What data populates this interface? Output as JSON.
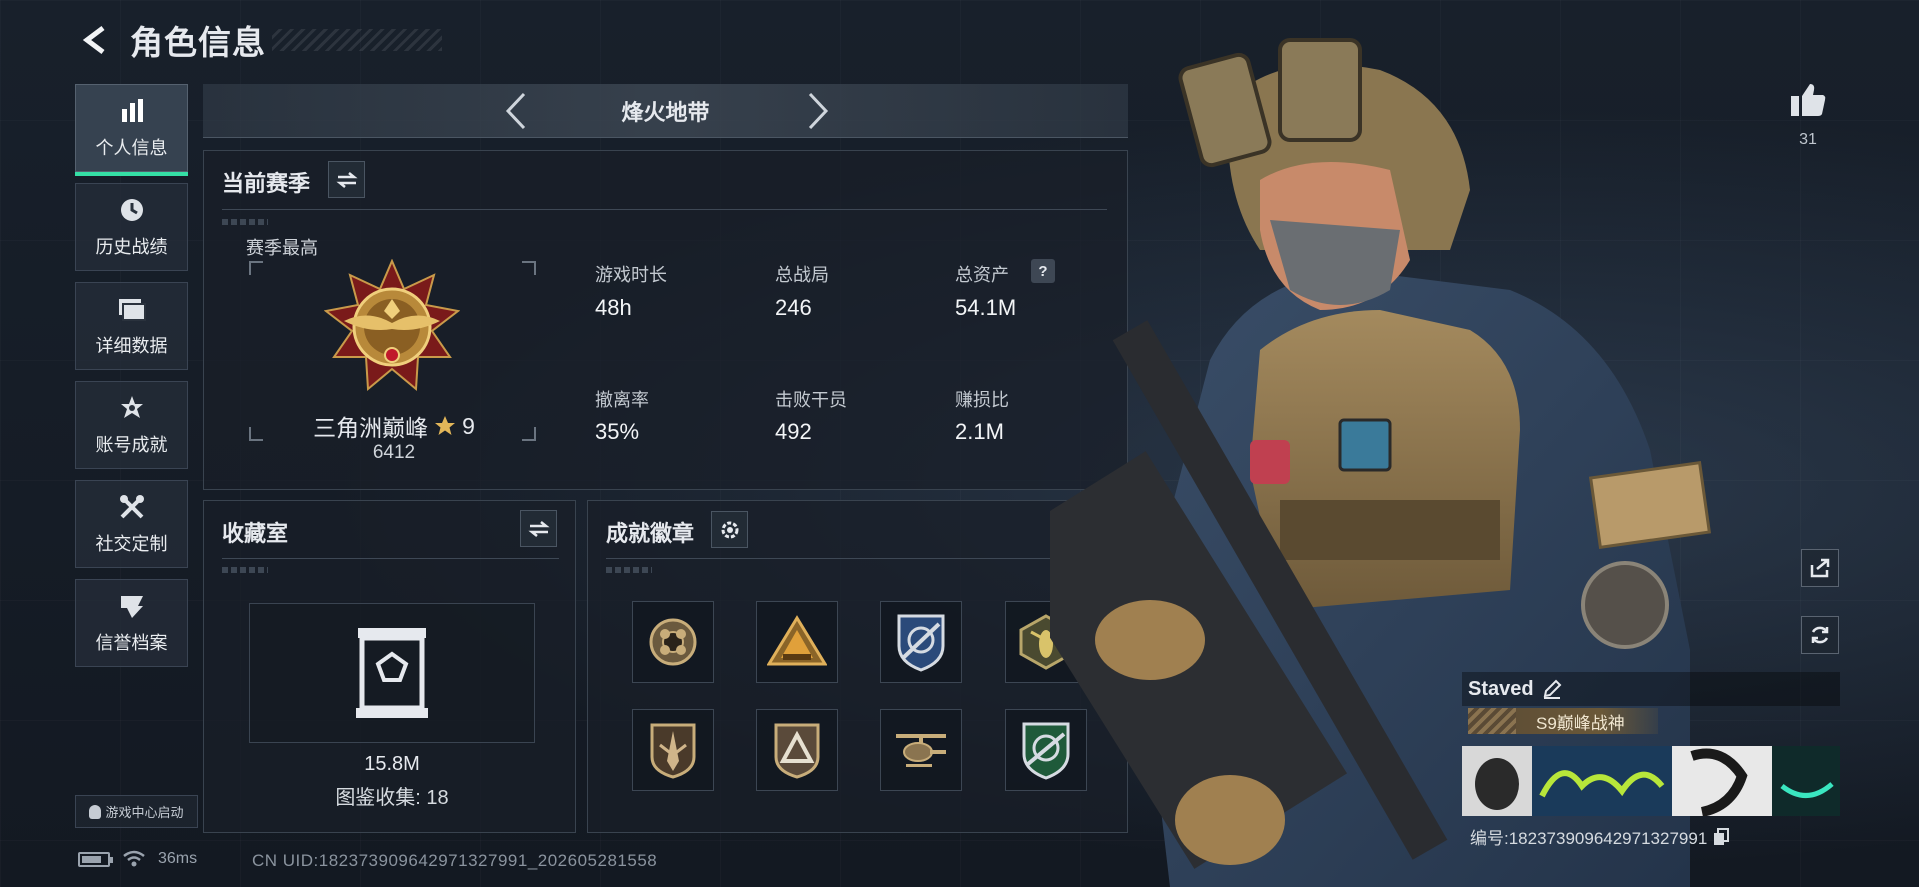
{
  "header": {
    "title": "角色信息"
  },
  "nav": {
    "items": [
      {
        "label": "个人信息",
        "icon": "bar-chart-icon",
        "active": true
      },
      {
        "label": "历史战绩",
        "icon": "clock-icon"
      },
      {
        "label": "详细数据",
        "icon": "folder-icon"
      },
      {
        "label": "账号成就",
        "icon": "achievement-star-icon"
      },
      {
        "label": "社交定制",
        "icon": "tools-icon"
      },
      {
        "label": "信誉档案",
        "icon": "reputation-emblem-icon"
      }
    ],
    "game_center": "游戏中心启动"
  },
  "status": {
    "ping": "36ms",
    "uid": "CN UID:1823739096429713279​91_202605281558"
  },
  "mode": {
    "title": "烽火地带"
  },
  "season": {
    "title": "当前赛季",
    "peak_label": "赛季最高",
    "rank_name": "三角洲巅峰",
    "rank_stars": "9",
    "rank_score": "6412",
    "stats": [
      {
        "label": "游戏时长",
        "value": "48h"
      },
      {
        "label": "总战局",
        "value": "246"
      },
      {
        "label": "总资产",
        "value": "54.1M",
        "help": "?"
      },
      {
        "label": "撤离率",
        "value": "35%"
      },
      {
        "label": "击败干员",
        "value": "492"
      },
      {
        "label": "赚损比",
        "value": "2.1M"
      }
    ]
  },
  "collection": {
    "title": "收藏室",
    "value": "15.8M",
    "count_text": "图鉴收集:  18"
  },
  "badges": {
    "title": "成就徽章",
    "items": [
      "rose-emblem",
      "pyramid-emblem",
      "shield-target-emblem",
      "wasp-emblem",
      "sword-emblem",
      "triangle-emblem",
      "helicopter-emblem",
      "green-shield-emblem"
    ]
  },
  "profile": {
    "likes": "31",
    "player_name": "Staved",
    "title_tag": "S9巅峰战神",
    "player_id": "编号:1823739096429713279​91"
  },
  "colors": {
    "accent": "#35e0a6",
    "background": "#151b24",
    "panel_border": "#39434f"
  }
}
